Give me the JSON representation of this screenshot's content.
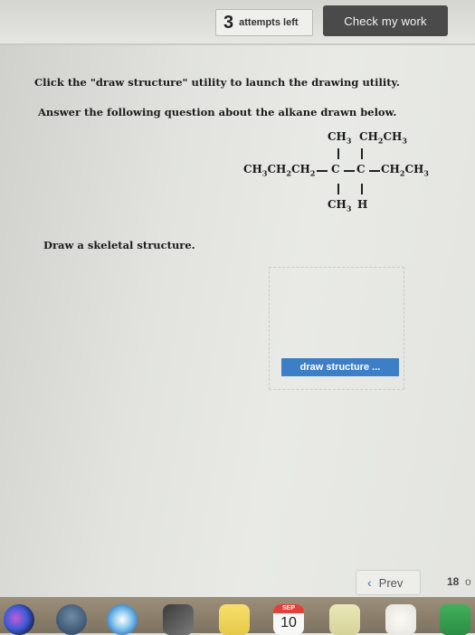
{
  "header": {
    "attempts_number": "3",
    "attempts_label": "attempts left",
    "check_button": "Check my work"
  },
  "instructions": {
    "line1": "Click the \"draw structure\" utility to launch the drawing utility.",
    "line2": "Answer the following question about the alkane drawn below."
  },
  "molecule": {
    "top_left": "CH3",
    "top_right": "CH2CH3",
    "main_chain_left": "CH3CH2CH2",
    "carbon1": "C",
    "carbon2": "C",
    "main_chain_right": "CH2CH3",
    "bottom_left": "CH3",
    "bottom_right": "H"
  },
  "prompt": {
    "skeletal": "Draw a skeletal structure."
  },
  "draw_button": {
    "label": "draw structure ..."
  },
  "navigation": {
    "prev_chevron": "‹",
    "prev_label": "Prev",
    "page_number": "18",
    "next_hint": "o"
  },
  "dock": {
    "calendar_month": "SEP",
    "calendar_day": "10"
  }
}
